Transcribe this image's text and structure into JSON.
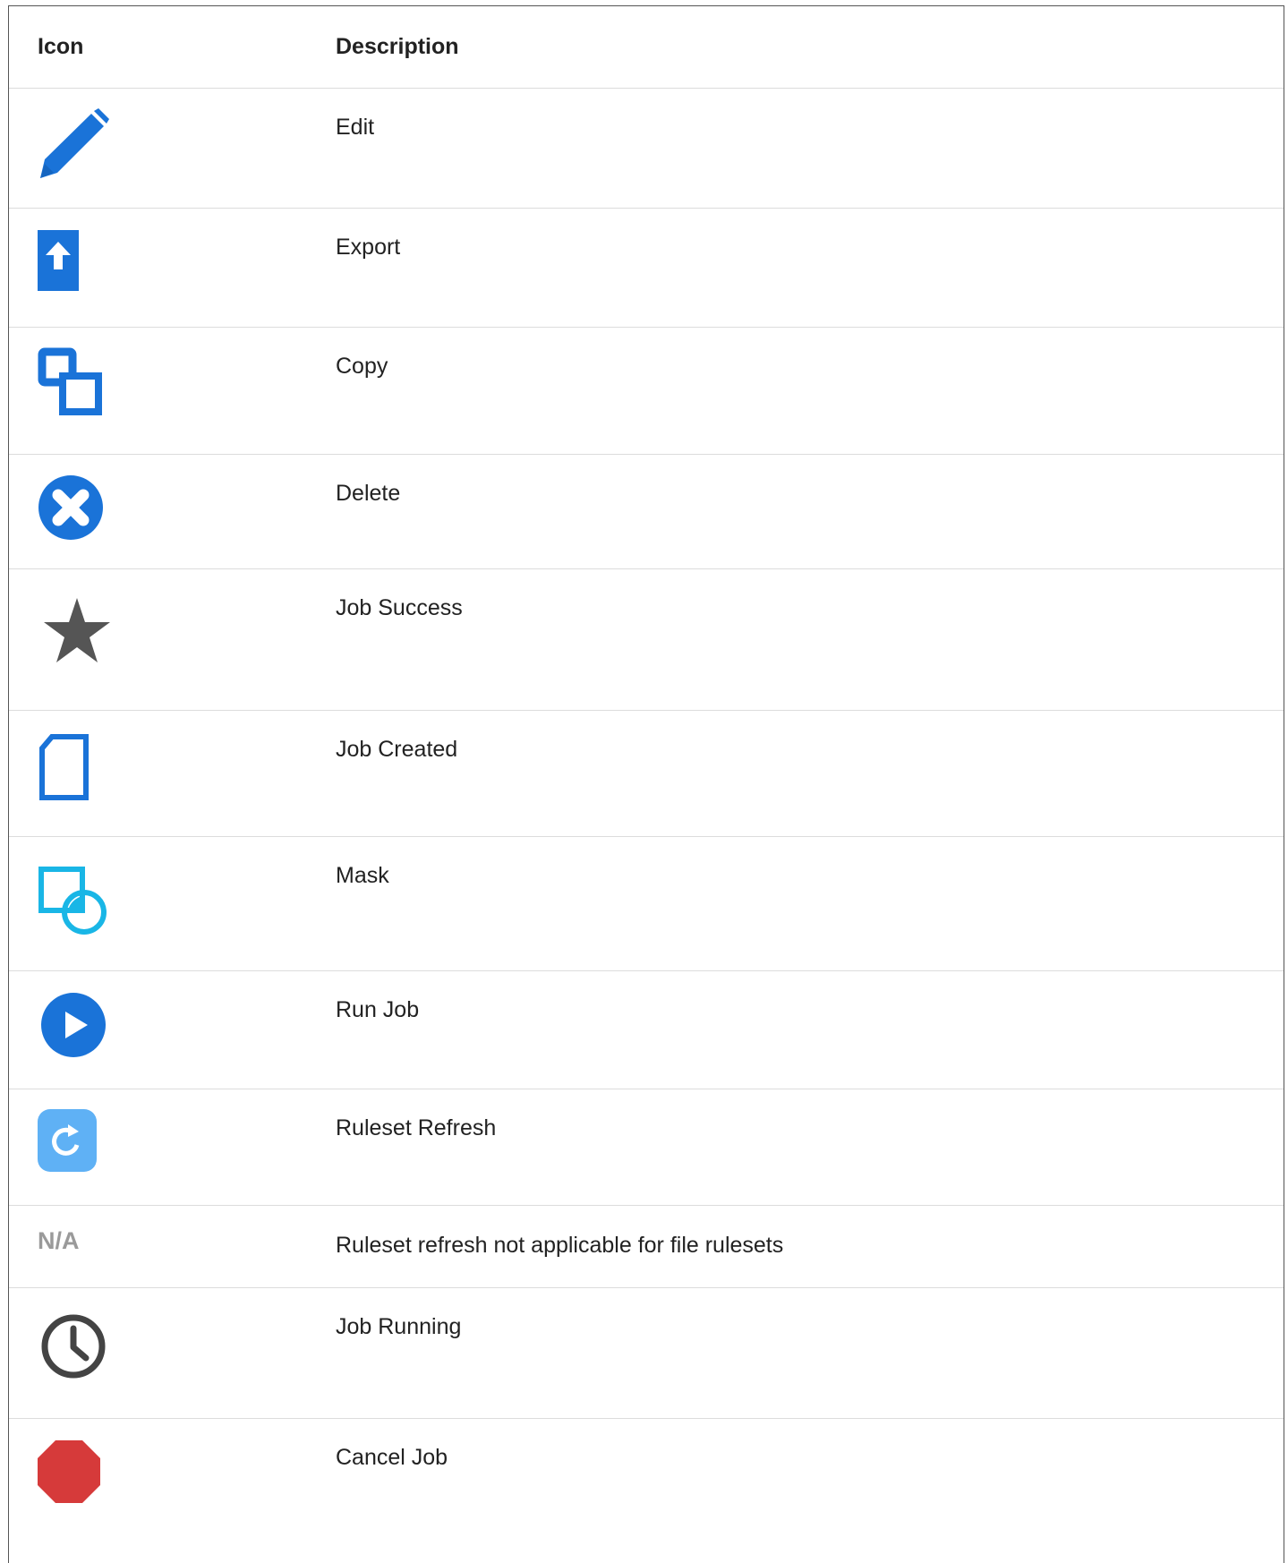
{
  "headers": {
    "icon": "Icon",
    "description": "Description"
  },
  "rows": [
    {
      "icon": "pencil-icon",
      "label": "Edit"
    },
    {
      "icon": "export-icon",
      "label": "Export"
    },
    {
      "icon": "copy-icon",
      "label": "Copy"
    },
    {
      "icon": "delete-icon",
      "label": "Delete"
    },
    {
      "icon": "star-icon",
      "label": "Job Success"
    },
    {
      "icon": "document-icon",
      "label": "Job Created"
    },
    {
      "icon": "mask-icon",
      "label": "Mask"
    },
    {
      "icon": "play-icon",
      "label": "Run Job"
    },
    {
      "icon": "refresh-icon",
      "label": "Ruleset Refresh"
    },
    {
      "icon": "na-text",
      "icon_text": "N/A",
      "label": "Ruleset refresh not applicable for file rulesets"
    },
    {
      "icon": "clock-icon",
      "label": "Job Running"
    },
    {
      "icon": "stop-icon",
      "label": "Cancel Job"
    }
  ],
  "colors": {
    "blue": "#1a73d8",
    "cyan": "#19b6e6",
    "light_blue": "#5fb1f5",
    "gray_icon": "#555555",
    "clock": "#444444",
    "red": "#d63a3a",
    "na_text": "#9a9a9a"
  }
}
